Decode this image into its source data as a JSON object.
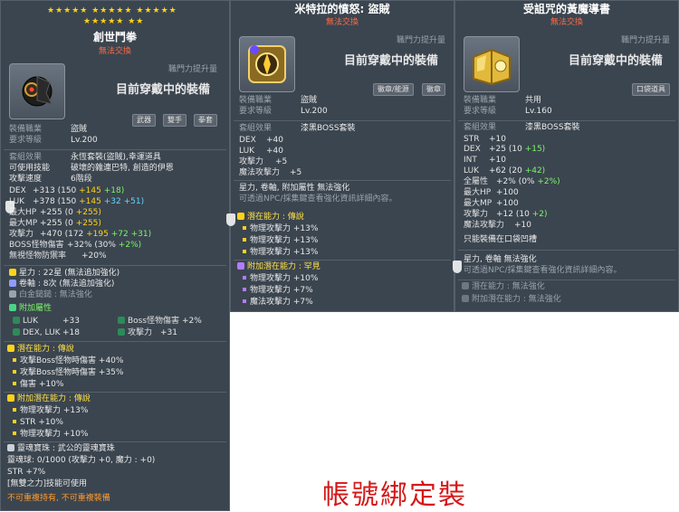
{
  "panel1": {
    "stars_row1": "★★★★★ ★★★★★ ★★★★★",
    "stars_row2": "★★★★★ ★★",
    "title": "創世鬥拳",
    "subtitle": "無法交換",
    "job_hint": "職門力提升量",
    "equip_status": "目前穿戴中的裝備",
    "tags": [
      "武器",
      "雙手",
      "拳套"
    ],
    "job_label": "裝備職業",
    "job_value": "盜賊",
    "level_label": "要求等級",
    "level_value": "Lv.200",
    "set_label": "套組效果",
    "set_value": "永恆套裝(盜賊),幸運道具",
    "skill_label": "可使用技能",
    "skill_value": "破壞的雜連巴特, 創造的伊恩",
    "speed_label": "攻擊速度",
    "speed_value": "6階段",
    "stats": [
      {
        "k": "DEX",
        "v": "+313 (150 ",
        "a": "+145",
        "b": " +18)"
      },
      {
        "k": "LUK",
        "v": "+378 (150 ",
        "a": "+145",
        "b": " +32 +51)"
      },
      {
        "k": "最大HP",
        "v": "+255 (0 ",
        "a": "+255)",
        "b": ""
      },
      {
        "k": "最大MP",
        "v": "+255 (0 ",
        "a": "+255)",
        "b": ""
      },
      {
        "k": "攻擊力",
        "v": "+470 (172 ",
        "a": "+195",
        "b": " +72 +31)"
      },
      {
        "k": "BOSS怪物傷害",
        "v": "+32% (30% ",
        "a": "+2%)",
        "b": ""
      },
      {
        "k": "無視怪物防禦率",
        "v": "+20%",
        "a": "",
        "b": ""
      }
    ],
    "starforce": "星力 : 22星 (無法追加強化)",
    "scroll": "卷軸 : 8次 (無法追加強化)",
    "nut": "白金鎚鎚 : 無法強化",
    "bonus_title": "附加屬性",
    "bonus": [
      {
        "k": "LUK",
        "v": "+33",
        "k2": "Boss怪物傷害",
        "v2": "+2%"
      },
      {
        "k": "DEX, LUK",
        "v": "+18",
        "k2": "攻擊力",
        "v2": "+31"
      }
    ],
    "potential_title": "潛在能力 : 傳說",
    "potential": [
      "攻擊Boss怪物時傷害 +40%",
      "攻擊Boss怪物時傷害 +35%",
      "傷害 +10%"
    ],
    "addpot_title": "附加潛在能力 : 傳說",
    "addpot": [
      "物理攻擊力 +13%",
      "STR +10%",
      "物理攻擊力 +10%"
    ],
    "soul_title": "靈魂寶珠 : 武公的靈魂寶珠",
    "soul_line": "靈魂球: 0/1000 (攻擊力 +0, 魔力 : +0)",
    "soul_str": "STR +7%",
    "soul_skill": "[無雙之力]技能可使用",
    "footer": "不可重複持有, 不可重複裝備"
  },
  "panel2": {
    "title": "米特拉的憤怒: 盜賊",
    "subtitle": "無法交換",
    "job_hint": "職門力提升量",
    "equip_status": "目前穿戴中的裝備",
    "tags": [
      "徽章/能源",
      "徽章"
    ],
    "job_label": "裝備職業",
    "job_value": "盜賊",
    "level_label": "要求等級",
    "level_value": "Lv.200",
    "set_label": "套組效果",
    "set_value": "漆黑BOSS套裝",
    "stats": [
      {
        "k": "DEX",
        "v": "+40"
      },
      {
        "k": "LUK",
        "v": "+40"
      },
      {
        "k": "攻擊力",
        "v": "+5"
      },
      {
        "k": "魔法攻擊力",
        "v": "+5"
      }
    ],
    "enhance": "星力, 卷軸, 附加屬性 無法強化",
    "enhance_hint": "可透過NPC/採集鍵查看強化資訊詳細內容。",
    "potential_title": "潛在能力 : 傳說",
    "potential": [
      "物理攻擊力 +13%",
      "物理攻擊力 +13%",
      "物理攻擊力 +13%"
    ],
    "addpot_title": "附加潛在能力 : 罕見",
    "addpot": [
      "物理攻擊力 +10%",
      "物理攻擊力 +7%",
      "魔法攻擊力 +7%"
    ]
  },
  "panel3": {
    "title": "受詛咒的黃魔導書",
    "subtitle": "無法交換",
    "job_hint": "職門力提升量",
    "equip_status": "目前穿戴中的裝備",
    "tags": [
      "口袋道具"
    ],
    "job_label": "裝備職業",
    "job_value": "共用",
    "level_label": "要求等級",
    "level_value": "Lv.160",
    "set_label": "套組效果",
    "set_value": "漆黑BOSS套裝",
    "stats": [
      {
        "k": "STR",
        "v": "+10",
        "x": ""
      },
      {
        "k": "DEX",
        "v": "+25 (10 ",
        "x": "+15)"
      },
      {
        "k": "INT",
        "v": "+10",
        "x": ""
      },
      {
        "k": "LUK",
        "v": "+62 (20 ",
        "x": "+42)"
      },
      {
        "k": "全屬性",
        "v": "+2% (0% ",
        "x": "+2%)"
      },
      {
        "k": "最大HP",
        "v": "+100",
        "x": ""
      },
      {
        "k": "最大MP",
        "v": "+100",
        "x": ""
      },
      {
        "k": "攻擊力",
        "v": "+12 (10 ",
        "x": "+2)"
      },
      {
        "k": "魔法攻擊力",
        "v": "+10",
        "x": ""
      }
    ],
    "slot_note": "只能裝備在口袋凹槽",
    "enhance": "星力, 卷軸 無法強化",
    "enhance_hint": "可透過NPC/採集鍵查看強化資訊詳細內容。",
    "potential_title": "潛在能力 : 無法強化",
    "addpot_title": "附加潛在能力 : 無法強化"
  },
  "caption": "帳號綁定裝"
}
